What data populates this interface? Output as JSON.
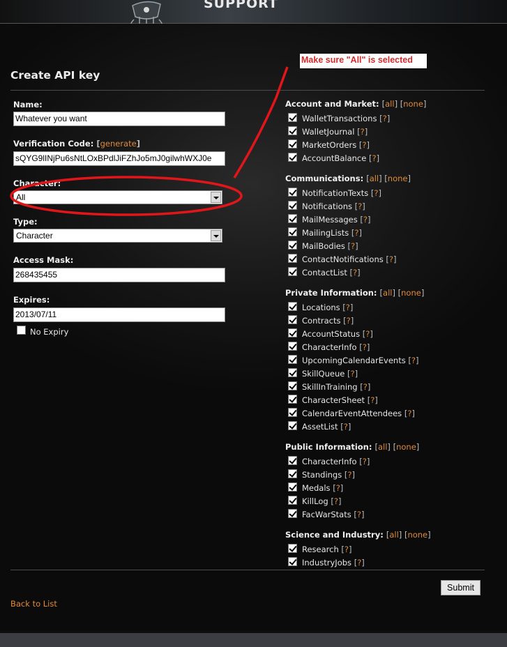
{
  "header": {
    "title": "SUPPORT"
  },
  "page": {
    "title": "Create API key"
  },
  "annotation": {
    "text": "Make sure \"All\" is selected"
  },
  "form": {
    "name": {
      "label": "Name:",
      "value": "Whatever you want"
    },
    "verification": {
      "label": "Verification Code:",
      "generate": "generate",
      "value": "sQYG9lINjPu6sNtLOxBPdlJiFZhJo5mJ0gilwhWXJ0e"
    },
    "character": {
      "label": "Character:",
      "value": "All"
    },
    "type": {
      "label": "Type:",
      "value": "Character"
    },
    "access_mask": {
      "label": "Access Mask:",
      "value": "268435455"
    },
    "expires": {
      "label": "Expires:",
      "value": "2013/07/11"
    },
    "no_expiry": {
      "label": "No Expiry",
      "checked": false
    }
  },
  "controls": {
    "all": "all",
    "none": "none",
    "help": "?"
  },
  "sections": [
    {
      "title": "Account and Market:",
      "items": [
        "WalletTransactions",
        "WalletJournal",
        "MarketOrders",
        "AccountBalance"
      ]
    },
    {
      "title": "Communications:",
      "items": [
        "NotificationTexts",
        "Notifications",
        "MailMessages",
        "MailingLists",
        "MailBodies",
        "ContactNotifications",
        "ContactList"
      ]
    },
    {
      "title": "Private Information:",
      "items": [
        "Locations",
        "Contracts",
        "AccountStatus",
        "CharacterInfo",
        "UpcomingCalendarEvents",
        "SkillQueue",
        "SkillInTraining",
        "CharacterSheet",
        "CalendarEventAttendees",
        "AssetList"
      ]
    },
    {
      "title": "Public Information:",
      "items": [
        "CharacterInfo",
        "Standings",
        "Medals",
        "KillLog",
        "FacWarStats"
      ]
    },
    {
      "title": "Science and Industry:",
      "items": [
        "Research",
        "IndustryJobs"
      ]
    }
  ],
  "actions": {
    "submit": "Submit",
    "back": "Back to List"
  },
  "colors": {
    "link": "#e08a3a",
    "annotation_red": "#d42a2a",
    "background": "#0d0d0d"
  }
}
